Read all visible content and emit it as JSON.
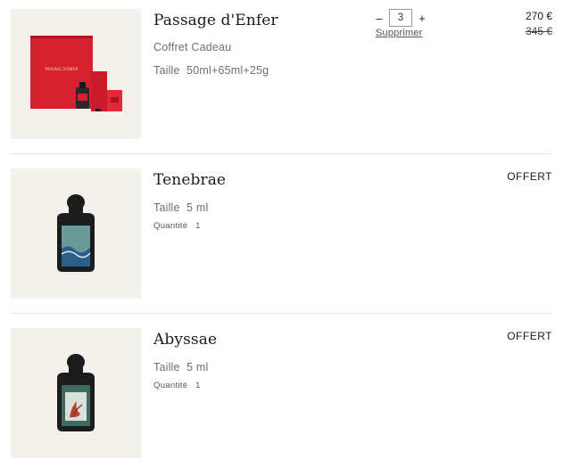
{
  "items": [
    {
      "name": "Passage d'Enfer",
      "subtitle": "Coffret Cadeau",
      "size_label": "Taille",
      "size_value": "50ml+65ml+25g",
      "quantity": "3",
      "qty_minus": "–",
      "qty_plus": "+",
      "remove_label": "Supprimer",
      "price": "270 €",
      "old_price": "345 €",
      "box_text": "PASSAGE D'ENFER"
    },
    {
      "name": "Tenebrae",
      "size_label": "Taille",
      "size_value": "5 ml",
      "quantity_label": "Quantité",
      "quantity": "1",
      "price_label": "OFFERT"
    },
    {
      "name": "Abyssae",
      "size_label": "Taille",
      "size_value": "5 ml",
      "quantity_label": "Quantité",
      "quantity": "1",
      "price_label": "OFFERT"
    }
  ],
  "colors": {
    "gift_box_red": "#d4202f",
    "thumb_bg": "#f2f1ec",
    "bottle_black": "#1c1c1c"
  }
}
